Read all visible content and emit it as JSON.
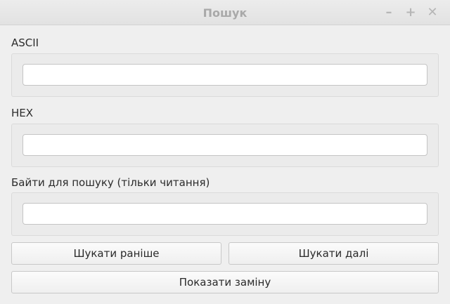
{
  "window": {
    "title": "Пошук",
    "minimize": "–",
    "maximize": "+",
    "close": "✕"
  },
  "fields": [
    {
      "label": "ASCII",
      "value": ""
    },
    {
      "label": "HEX",
      "value": ""
    },
    {
      "label": "Байти для пошуку (тільки читання)",
      "value": ""
    }
  ],
  "buttons": {
    "find_previous": "Шукати раніше",
    "find_next": "Шукати далі",
    "show_replace": "Показати заміну"
  }
}
